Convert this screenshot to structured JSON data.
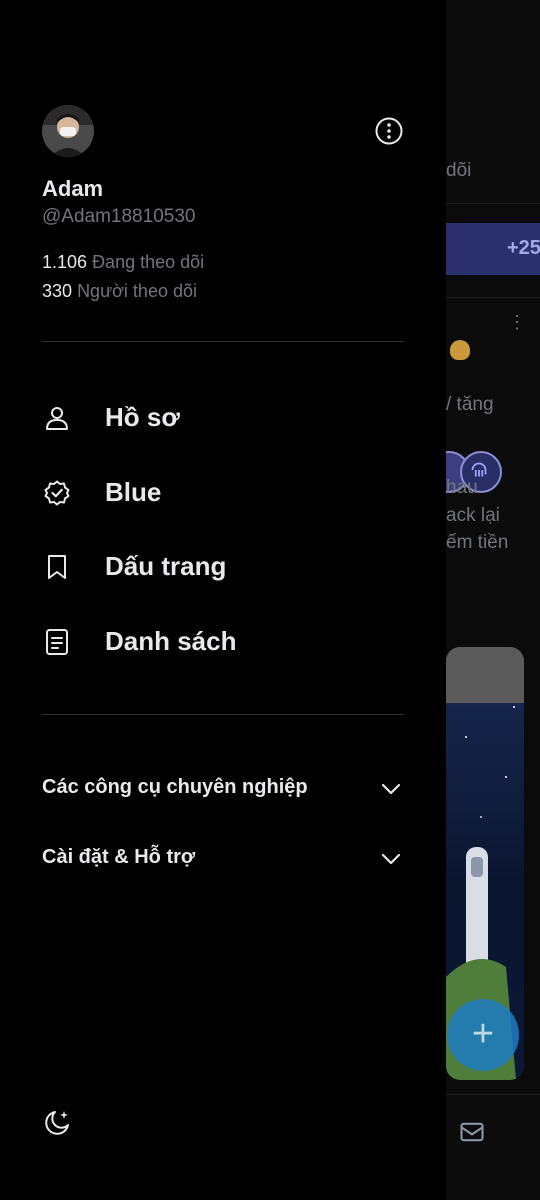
{
  "profile": {
    "name": "Adam",
    "handle": "@Adam18810530",
    "following_count": "1.106",
    "following_label": "Đang theo dõi",
    "followers_count": "330",
    "followers_label": "Người theo dõi"
  },
  "nav": {
    "profile": "Hồ sơ",
    "blue": "Blue",
    "bookmarks": "Dấu trang",
    "lists": "Danh sách"
  },
  "sections": {
    "pro_tools": "Các công cụ chuyên nghiệp",
    "settings": "Cài đặt & Hỗ trợ"
  },
  "background": {
    "tab_fragment": "dõi",
    "banner_count": "+25",
    "text1": "/ tăng",
    "text2": "hau",
    "text3": "ack lại",
    "text4": "ếm tiền"
  },
  "icons": {
    "more": "more-vertical-icon",
    "profile": "person-icon",
    "blue": "verified-badge-icon",
    "bookmarks": "bookmark-icon",
    "lists": "list-icon",
    "chevron": "chevron-down-icon",
    "theme": "moon-sparkle-icon",
    "mail": "mail-icon",
    "compose": "plus-icon"
  },
  "colors": {
    "background": "#000000",
    "primary_text": "#e7e9ea",
    "secondary_text": "#71767b",
    "divider": "#2f3336",
    "fab": "#1d7bc3"
  }
}
